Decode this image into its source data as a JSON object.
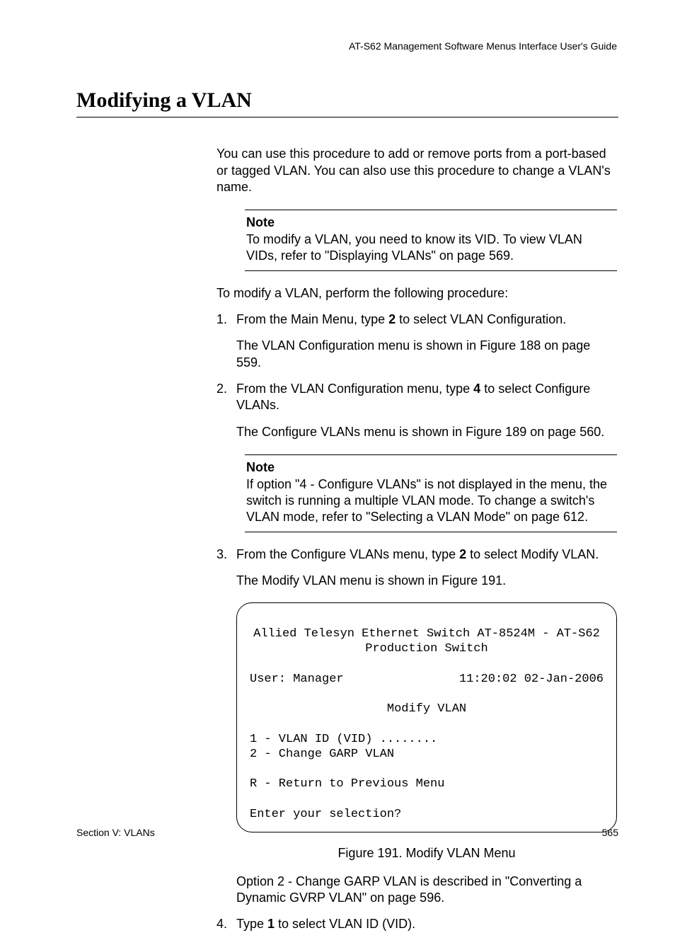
{
  "running_head": "AT-S62 Management Software Menus Interface User's Guide",
  "title": "Modifying a VLAN",
  "intro": "You can use this procedure to add or remove ports from a port-based or tagged VLAN. You can also use this procedure to change a VLAN's name.",
  "note1": {
    "label": "Note",
    "text": "To modify a VLAN, you need to know its VID. To view VLAN VIDs, refer to \"Displaying VLANs\" on page 569."
  },
  "lead_in": "To modify a VLAN, perform the following procedure:",
  "steps": {
    "s1": {
      "num": "1.",
      "pre": "From the Main Menu, type ",
      "bold": "2",
      "post": " to select VLAN Configuration.",
      "after": "The VLAN Configuration menu is shown in Figure 188 on page 559."
    },
    "s2": {
      "num": "2.",
      "pre": "From the VLAN Configuration menu, type ",
      "bold": "4",
      "post": " to select Configure VLANs.",
      "after": "The Configure VLANs menu is shown in Figure 189 on page 560."
    },
    "s3": {
      "num": "3.",
      "pre": "From the Configure VLANs menu, type ",
      "bold": "2",
      "post": " to select Modify VLAN.",
      "after": "The Modify VLAN menu is shown in Figure 191."
    },
    "s4": {
      "num": "4.",
      "pre": "Type ",
      "bold": "1",
      "post": " to select VLAN ID (VID)."
    }
  },
  "note2": {
    "label": "Note",
    "text": "If option \"4 - Configure VLANs\" is not displayed in the menu, the switch is running a multiple VLAN mode. To change a switch's VLAN mode, refer to \"Selecting a VLAN Mode\" on page 612."
  },
  "terminal": {
    "line1": "Allied Telesyn Ethernet Switch AT-8524M - AT-S62",
    "line2": "Production Switch",
    "user": "User: Manager",
    "time": "11:20:02 02-Jan-2006",
    "heading": "Modify VLAN",
    "opt1": "1 - VLAN ID (VID) ........",
    "opt2": "2 - Change GARP VLAN",
    "optR": "R - Return to Previous Menu",
    "prompt": "Enter your selection?"
  },
  "fig_caption": "Figure 191. Modify VLAN Menu",
  "after_fig": "Option 2 - Change GARP VLAN is described in \"Converting a Dynamic GVRP VLAN\" on page 596.",
  "footer": {
    "left": "Section V: VLANs",
    "right": "565"
  }
}
